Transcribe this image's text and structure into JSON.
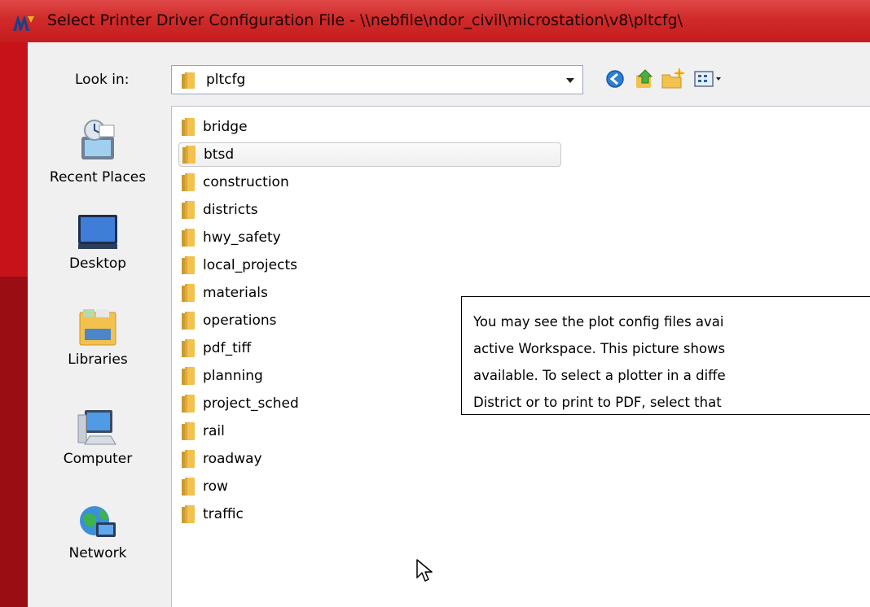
{
  "window": {
    "title": "Select Printer Driver Configuration File - \\\\nebfile\\ndor_civil\\microstation\\v8\\pltcfg\\"
  },
  "lookin": {
    "label": "Look in:",
    "value": "pltcfg"
  },
  "toolbar": {
    "back_icon": "back-icon",
    "up_icon": "up-folder-icon",
    "new_folder_icon": "new-folder-icon",
    "view_icon": "view-menu-icon"
  },
  "places": [
    {
      "label": "Recent Places",
      "icon": "recent-places-icon"
    },
    {
      "label": "Desktop",
      "icon": "desktop-icon"
    },
    {
      "label": "Libraries",
      "icon": "libraries-icon"
    },
    {
      "label": "Computer",
      "icon": "computer-icon"
    },
    {
      "label": "Network",
      "icon": "network-icon"
    }
  ],
  "folders": [
    {
      "label": "bridge"
    },
    {
      "label": "btsd"
    },
    {
      "label": "construction"
    },
    {
      "label": "districts"
    },
    {
      "label": "hwy_safety"
    },
    {
      "label": "local_projects"
    },
    {
      "label": "materials"
    },
    {
      "label": "operations"
    },
    {
      "label": "pdf_tiff"
    },
    {
      "label": "planning"
    },
    {
      "label": "project_sched"
    },
    {
      "label": "rail"
    },
    {
      "label": "roadway"
    },
    {
      "label": "row"
    },
    {
      "label": "traffic"
    }
  ],
  "selected_folder": "btsd",
  "callout": {
    "lines": [
      "You may see the plot config files avai",
      "active Workspace. This picture shows",
      "available. To select a plotter in a diffe",
      "District or to print to PDF, select that"
    ]
  },
  "colors": {
    "titlebar": "#d02a2a",
    "folder": "#f2c14e"
  }
}
